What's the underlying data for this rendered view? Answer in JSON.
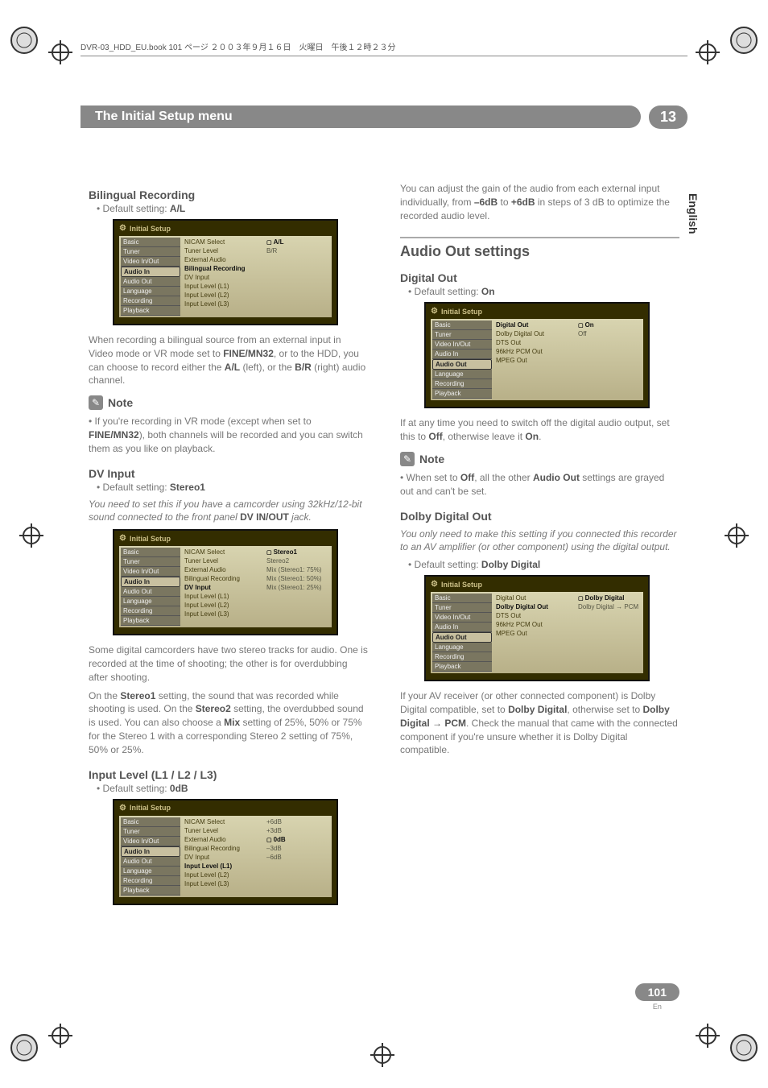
{
  "topstrip": "DVR-03_HDD_EU.book  101 ページ  ２００３年９月１６日　火曜日　午後１２時２３分",
  "header": {
    "title": "The Initial Setup menu",
    "chapter": "13"
  },
  "lang_tab": "English",
  "page": {
    "number": "101",
    "lang": "En"
  },
  "left": {
    "bilingual": {
      "heading": "Bilingual Recording",
      "default_prefix": "• Default setting: ",
      "default_value": "A/L",
      "para1a": "When recording a bilingual source from an external input in Video mode or VR mode set to ",
      "para1b": "FINE/MN32",
      "para1c": ", or to the HDD, you can choose to record either the ",
      "para1d": "A/L",
      "para1e": " (left), or the ",
      "para1f": "B/R",
      "para1g": " (right) audio channel.",
      "note_label": "Note",
      "note1a": "• If you're recording in VR mode (except when set to ",
      "note1b": "FINE/MN32",
      "note1c": "), both channels will be recorded and you can switch them as you like on playback."
    },
    "dvinput": {
      "heading": "DV Input",
      "default_prefix": "• Default setting: ",
      "default_value": "Stereo1",
      "ital1": "You need to set this if you have a camcorder using 32kHz/12-bit sound connected to the front panel ",
      "ital_bold": "DV IN/OUT",
      "ital2": " jack.",
      "para2": "Some digital camcorders have two stereo tracks for audio. One is recorded at the time of shooting; the other is for overdubbing after shooting.",
      "para3a": "On the ",
      "para3b": "Stereo1",
      "para3c": " setting, the sound that was recorded while shooting is used. On the ",
      "para3d": "Stereo2",
      "para3e": " setting, the overdubbed sound is used. You can also choose a ",
      "para3f": "Mix",
      "para3g": " setting of 25%, 50% or 75% for the Stereo 1 with a corresponding Stereo 2 setting of 75%, 50% or 25%."
    },
    "inputlevel": {
      "heading": "Input Level (L1 / L2 / L3)",
      "default_prefix": "• Default setting: ",
      "default_value": "0dB"
    },
    "menu_common": {
      "title": "Initial Setup",
      "cats": [
        "Basic",
        "Tuner",
        "Video In/Out",
        "Audio In",
        "Audio Out",
        "Language",
        "Recording",
        "Playback"
      ],
      "items_audioin": [
        "NICAM Select",
        "Tuner Level",
        "External Audio",
        "Bilingual Recording",
        "DV Input",
        "Input Level (L1)",
        "Input Level (L2)",
        "Input Level (L3)"
      ]
    },
    "menu1_values": [
      "A/L",
      "B/R"
    ],
    "menu2_values": [
      "Stereo1",
      "Stereo2",
      "Mix (Stereo1: 75%)",
      "Mix (Stereo1: 50%)",
      "Mix (Stereo1: 25%)"
    ],
    "menu3_values": [
      "+6dB",
      "+3dB",
      "0dB",
      "–3dB",
      "–6dB"
    ]
  },
  "right": {
    "intro1a": "You can adjust the gain of the audio from each external input individually, from ",
    "intro1b": "–6dB",
    "intro1c": " to ",
    "intro1d": "+6dB",
    "intro1e": " in steps of 3 dB to optimize the recorded audio level.",
    "audio_out_heading": "Audio Out settings",
    "digital_out": {
      "heading": "Digital Out",
      "default_prefix": "• Default setting: ",
      "default_value": "On",
      "para1a": "If at any time you need to switch off the digital audio output, set this to ",
      "para1b": "Off",
      "para1c": ", otherwise leave it ",
      "para1d": "On",
      "para1e": ".",
      "note_label": "Note",
      "note1a": "• When set to ",
      "note1b": "Off",
      "note1c": ", all the other ",
      "note1d": "Audio Out",
      "note1e": " settings are grayed out and can't be set."
    },
    "dolby": {
      "heading": "Dolby Digital Out",
      "ital": "You only need to make this setting if you connected this recorder to an AV amplifier (or other component) using the digital output.",
      "default_prefix": "• Default setting: ",
      "default_value": "Dolby Digital",
      "para1a": "If your AV receiver (or other connected component) is Dolby Digital compatible, set to ",
      "para1b": "Dolby Digital",
      "para1c": ", otherwise set to ",
      "para1d": "Dolby Digital → PCM",
      "para1e": ". Check the manual that came with the connected component if you're unsure whether it is Dolby Digital compatible."
    },
    "menu_audioout_items": [
      "Digital Out",
      "Dolby Digital Out",
      "DTS Out",
      "96kHz PCM Out",
      "MPEG Out"
    ],
    "menu_digitalout_values": [
      "On",
      "Off"
    ],
    "menu_dolby_values": [
      "Dolby Digital",
      "Dolby Digital → PCM"
    ]
  }
}
